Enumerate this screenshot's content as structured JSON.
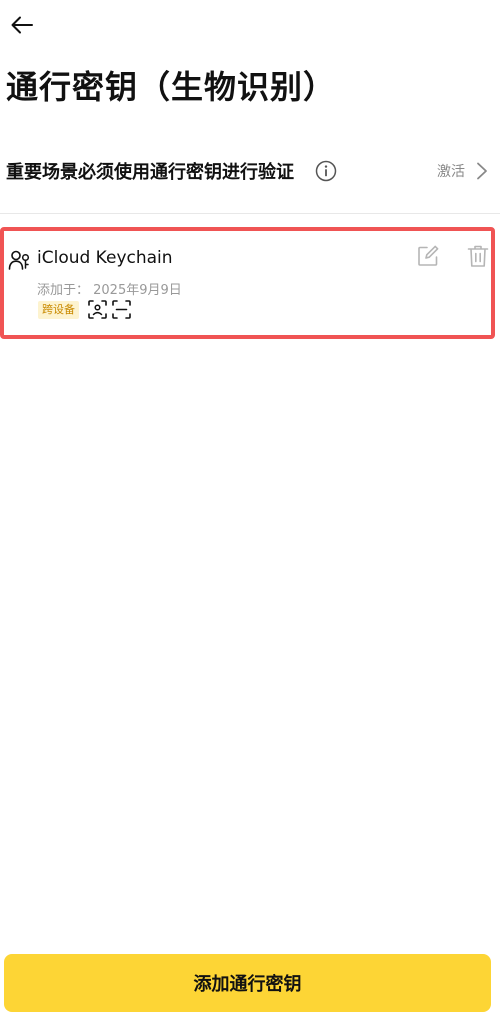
{
  "header": {
    "title": "通行密钥（生物识别）"
  },
  "setting": {
    "label": "重要场景必须使用通行密钥进行验证",
    "status": "激活"
  },
  "passkeys": [
    {
      "name": "iCloud Keychain",
      "added": "添加于：  2025年9月9日",
      "badge": "跨设备"
    }
  ],
  "footer": {
    "add_label": "添加通行密钥"
  },
  "colors": {
    "accent": "#fdd535",
    "highlight_border": "#f05454",
    "badge_bg": "#fdf3cf",
    "badge_text": "#c98a00"
  },
  "icons": {
    "back": "arrow-left-icon",
    "info": "info-icon",
    "chevron": "chevron-right-icon",
    "user": "users-icon",
    "face": "face-id-icon",
    "scan": "scan-frame-icon",
    "edit": "edit-icon",
    "delete": "trash-icon"
  }
}
